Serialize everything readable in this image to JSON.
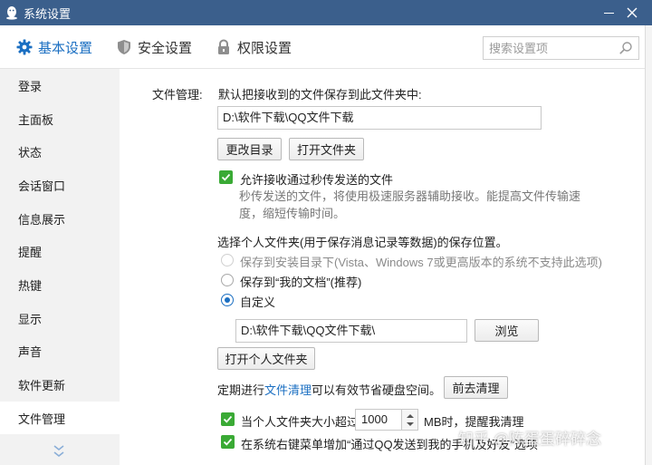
{
  "window": {
    "title": "系统设置"
  },
  "tabs": [
    {
      "label": "基本设置",
      "icon": "gear-icon"
    },
    {
      "label": "安全设置",
      "icon": "shield-icon"
    },
    {
      "label": "权限设置",
      "icon": "lock-icon"
    }
  ],
  "search": {
    "placeholder": "搜索设置项"
  },
  "sidebar": {
    "items": [
      {
        "label": "登录"
      },
      {
        "label": "主面板"
      },
      {
        "label": "状态"
      },
      {
        "label": "会话窗口"
      },
      {
        "label": "信息展示"
      },
      {
        "label": "提醒"
      },
      {
        "label": "热键"
      },
      {
        "label": "显示"
      },
      {
        "label": "声音"
      },
      {
        "label": "软件更新"
      },
      {
        "label": "文件管理"
      }
    ],
    "active_index": 10
  },
  "file_mgmt": {
    "section_label": "文件管理:",
    "save_folder_label": "默认把接收到的文件保存到此文件夹中:",
    "save_folder_path": "D:\\软件下载\\QQ文件下载",
    "change_dir_button": "更改目录",
    "open_folder_button": "打开文件夹",
    "allow_instant": {
      "label": "允许接收通过秒传发送的文件",
      "checked": true,
      "desc_line1": "秒传发送的文件，将使用极速服务器辅助接收。能提高文件传输速",
      "desc_line2": "度，缩短传输时间。"
    },
    "personal_folder_label": "选择个人文件夹(用于保存消息记录等数据)的保存位置。",
    "options": [
      {
        "label": "保存到安装目录下(Vista、Windows 7或更高版本的系统不支持此选项)",
        "disabled": true,
        "selected": false
      },
      {
        "label": "保存到“我的文档”(推荐)",
        "disabled": false,
        "selected": false
      },
      {
        "label": "自定义",
        "disabled": false,
        "selected": true
      }
    ],
    "custom_path": "D:\\软件下载\\QQ文件下载\\",
    "browse_button": "浏览",
    "open_personal_button": "打开个人文件夹",
    "cleanup_prefix": "定期进行",
    "cleanup_link": "文件清理",
    "cleanup_suffix": "可以有效节省硬盘空间。",
    "cleanup_button": "前去清理",
    "size_alert": {
      "prefix": "当个人文件夹大小超过",
      "value": "1000",
      "suffix": "MB时，提醒我清理",
      "checked": true
    },
    "context_menu": {
      "label": "在系统右键菜单增加“通过QQ发送到我的手机及好友”选项",
      "checked": true
    }
  },
  "watermark": "知乎 @陈蛋蛋碎碎念",
  "colors": {
    "titlebar": "#3b5f8c",
    "accent": "#1b6fc2",
    "check": "#3aaa35"
  }
}
